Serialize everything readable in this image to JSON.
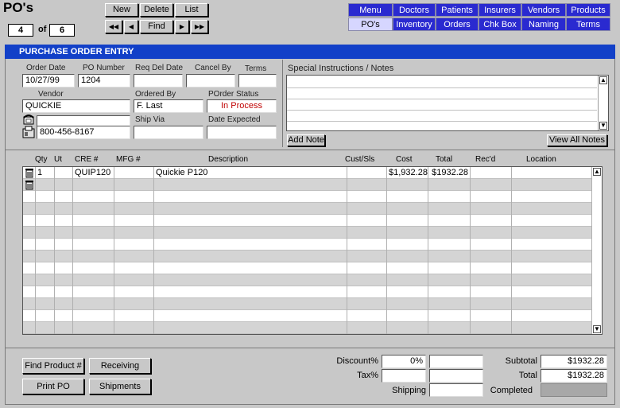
{
  "window": {
    "title": "PO's"
  },
  "record": {
    "current": "4",
    "of_label": "of",
    "total": "6"
  },
  "toolbar": {
    "new": "New",
    "delete": "Delete",
    "list": "List",
    "first": "◀◀",
    "prev": "◀",
    "find": "Find",
    "next": "▶",
    "last": "▶▶"
  },
  "nav_row1": [
    "Menu",
    "Doctors",
    "Patients",
    "Insurers",
    "Vendors",
    "Products"
  ],
  "nav_row2": [
    "PO's",
    "Inventory",
    "Orders",
    "Chk Box",
    "Naming",
    "Terms"
  ],
  "banner": "PURCHASE ORDER ENTRY",
  "header": {
    "order_date_label": "Order Date",
    "order_date": "10/27/99",
    "po_number_label": "PO Number",
    "po_number": "1204",
    "req_del_date_label": "Req Del Date",
    "req_del_date": "",
    "cancel_by_label": "Cancel By",
    "cancel_by": "",
    "terms_label": "Terms",
    "terms": "",
    "vendor_label": "Vendor",
    "vendor": "QUICKIE",
    "ordered_by_label": "Ordered By",
    "ordered_by": "F. Last",
    "porder_status_label": "POrder Status",
    "porder_status": "In Process",
    "ship_via_label": "Ship Via",
    "ship_via": "",
    "date_expected_label": "Date Expected",
    "date_expected": "",
    "phone1": "",
    "phone2": "800-456-8167",
    "notes_label": "Special Instructions / Notes",
    "add_note": "Add Note",
    "view_all_notes": "View All Notes"
  },
  "columns": [
    "Qty",
    "Ut",
    "CRE #",
    "MFG #",
    "Description",
    "Cust/Sls",
    "Cost",
    "Total",
    "Rec'd",
    "Location"
  ],
  "rows": [
    {
      "qty": "1",
      "ut": "",
      "cre": "QUIP120",
      "mfg": "",
      "desc": "Quickie P120",
      "cust": "",
      "cost": "$1,932.28",
      "total": "$1932.28",
      "recd": "",
      "loc": ""
    }
  ],
  "buttons": {
    "find_product": "Find Product #",
    "receiving": "Receiving",
    "print_po": "Print PO",
    "shipments": "Shipments"
  },
  "totals": {
    "discount_label": "Discount%",
    "discount": "0%",
    "tax_label": "Tax%",
    "tax": "",
    "shipping_label": "Shipping",
    "shipping": "",
    "subtotal_label": "Subtotal",
    "subtotal": "$1932.28",
    "total_label": "Total",
    "total": "$1932.28",
    "completed_label": "Completed"
  },
  "icons": {
    "trash": "trash-icon",
    "phone": "phone-icon",
    "fax": "fax-icon"
  },
  "colors": {
    "banner": "#1240c8",
    "nav": "#2a2ad0",
    "nav_active": "#d6d6ff",
    "status": "#c00000"
  }
}
